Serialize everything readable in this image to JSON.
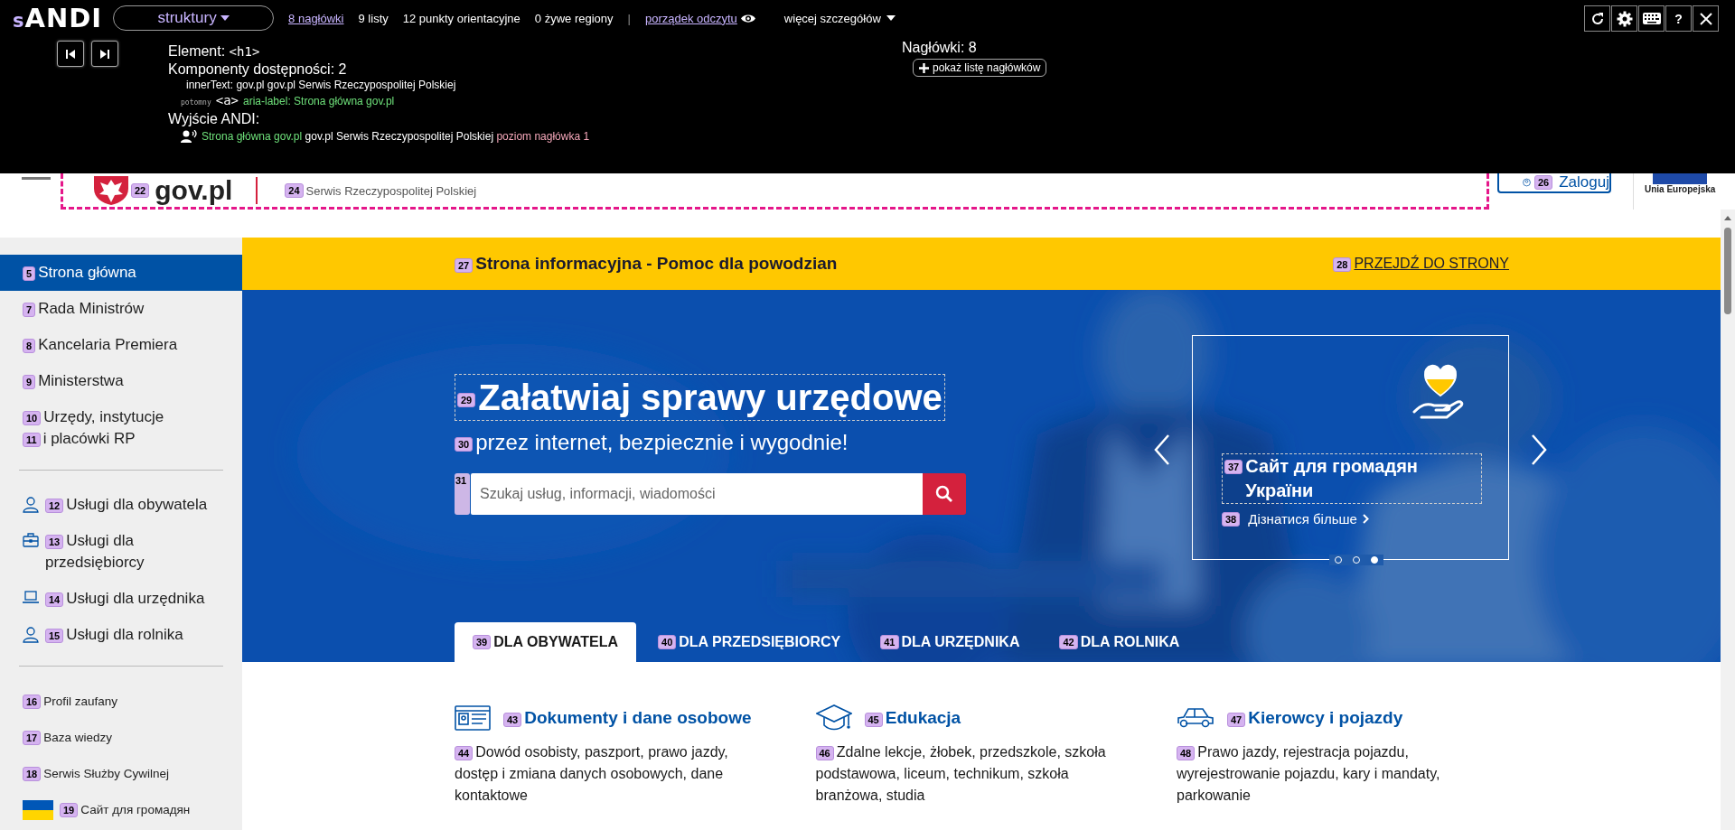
{
  "andi": {
    "logo_prefix": "s",
    "logo": "ANDI",
    "module_menu": "struktury",
    "summary": [
      {
        "text": "8 nagłówki",
        "kind": "link"
      },
      {
        "text": "9 listy",
        "kind": "text"
      },
      {
        "text": "12 punkty orientacyjne",
        "kind": "text"
      },
      {
        "text": "0 żywe regiony",
        "kind": "text"
      },
      {
        "text": "|",
        "kind": "separator"
      },
      {
        "text": "porządek odczytu",
        "kind": "eye_link"
      }
    ],
    "more_details": "więcej szczegółów",
    "help_button": "?",
    "element_label": "Element:",
    "element_tag": "<h1>",
    "components": "Komponenty dostępności: 2",
    "inner_text_label": "innerText:",
    "inner_text": "gov.pl gov.pl Serwis Rzeczypospolitej Polskiej",
    "descendant_label": "potomny",
    "descendant_tag": "<a>",
    "aria_label": "aria-label: Strona główna gov.pl",
    "output_label": "Wyjście ANDI:",
    "output": [
      {
        "text": "Strona główna gov.pl",
        "kind": "name"
      },
      {
        "text": "gov.pl Serwis Rzeczypospolitej Polskiej",
        "kind": "text"
      },
      {
        "text": "poziom nagłówka 1",
        "kind": "role"
      }
    ],
    "headings_count": "Nagłówki: 8",
    "headings_button": "pokaż listę nagłówków"
  },
  "header": {
    "logo_badge": "22",
    "logo": "gov.pl",
    "tagline_badge": "24",
    "tagline": "Serwis Rzeczypospolitej Polskiej",
    "login_badge": "26",
    "login": "Zaloguj",
    "eu_label": "Unia Europejska"
  },
  "sidebar": {
    "groups": [
      {
        "kind": "main",
        "items": [
          {
            "selected": true,
            "parts": [
              {
                "badge": "5",
                "text": "Strona główna"
              }
            ]
          },
          {
            "selected": false,
            "parts": [
              {
                "badge": "7",
                "text": "Rada Ministrów"
              }
            ]
          },
          {
            "selected": false,
            "parts": [
              {
                "badge": "8",
                "text": "Kancelaria Premiera"
              }
            ]
          },
          {
            "selected": false,
            "parts": [
              {
                "badge": "9",
                "text": "Ministerstwa"
              }
            ]
          },
          {
            "selected": false,
            "parts": [
              {
                "badge": "10",
                "text": "Urzędy, instytucje"
              },
              {
                "badge": "11",
                "text": "i placówki RP"
              }
            ]
          }
        ]
      },
      {
        "kind": "services",
        "items": [
          {
            "selected": false,
            "parts": [
              {
                "badge": "12",
                "text": "Usługi dla obywatela"
              }
            ]
          },
          {
            "selected": false,
            "parts": [
              {
                "badge": "13",
                "text": "Usługi dla przedsiębiorcy"
              }
            ]
          },
          {
            "selected": false,
            "parts": [
              {
                "badge": "14",
                "text": "Usługi dla urzędnika"
              }
            ]
          },
          {
            "selected": false,
            "parts": [
              {
                "badge": "15",
                "text": "Usługi dla rolnika"
              }
            ]
          }
        ]
      },
      {
        "kind": "links",
        "items": [
          {
            "selected": false,
            "parts": [
              {
                "badge": "16",
                "text": "Profil zaufany"
              }
            ]
          },
          {
            "selected": false,
            "parts": [
              {
                "badge": "17",
                "text": "Baza wiedzy"
              }
            ]
          },
          {
            "selected": false,
            "parts": [
              {
                "badge": "18",
                "text": "Serwis Służby Cywilnej"
              }
            ]
          },
          {
            "selected": false,
            "parts": [
              {
                "badge": "19",
                "text": "Сайт для громадян"
              }
            ]
          }
        ]
      }
    ]
  },
  "banner": {
    "badge": "27",
    "title": "Strona informacyjna - Pomoc dla powodzian",
    "link_badge": "28",
    "link": "PRZEJDŹ DO STRONY"
  },
  "hero": {
    "title_badge": "29",
    "title": "Załatwiaj sprawy urzędowe",
    "subtitle_badge": "30",
    "subtitle": "przez internet, bezpiecznie i wygodnie!",
    "search": {
      "badge": "31",
      "placeholder": "Szukaj usług, informacji, wiadomości"
    },
    "card": {
      "title_badge": "37",
      "title": "Сайт для громадян України",
      "link_badge": "38",
      "link": "Дізнатися більше",
      "dots": [
        {
          "selected": false
        },
        {
          "selected": false
        },
        {
          "selected": true
        }
      ]
    },
    "tabs": [
      {
        "badge": "39",
        "label": "DLA OBYWATELA",
        "selected": true
      },
      {
        "badge": "40",
        "label": "DLA PRZEDSIĘBIORCY",
        "selected": false
      },
      {
        "badge": "41",
        "label": "DLA URZĘDNIKA",
        "selected": false
      },
      {
        "badge": "42",
        "label": "DLA ROLNIKA",
        "selected": false
      }
    ]
  },
  "categories": [
    {
      "title_badge": "43",
      "title": "Dokumenty i dane osobowe",
      "desc_badge": "44",
      "desc": "Dowód osobisty, paszport, prawo jazdy, dostęp i zmiana danych osobowych, dane kontaktowe"
    },
    {
      "title_badge": "45",
      "title": "Edukacja",
      "desc_badge": "46",
      "desc": "Zdalne lekcje, żłobek, przedszkole, szkoła podstawowa, liceum, technikum, szkoła branżowa, studia"
    },
    {
      "title_badge": "47",
      "title": "Kierowcy i pojazdy",
      "desc_badge": "48",
      "desc": "Prawo jazdy, rejestracja pojazdu, wyrejestrowanie pojazdu, kary i mandaty, parkowanie"
    }
  ]
}
